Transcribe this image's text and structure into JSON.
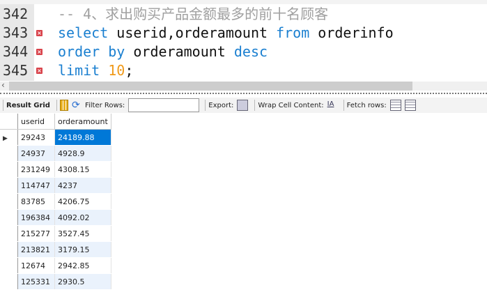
{
  "editor": {
    "lines": [
      {
        "num": "342",
        "error": false,
        "tokens": [
          {
            "t": "-- 4、求出购买产品金额最多的前十名顾客",
            "c": "cm"
          }
        ]
      },
      {
        "num": "343",
        "error": true,
        "tokens": [
          {
            "t": "select",
            "c": "kw"
          },
          {
            "t": " userid,orderamount ",
            "c": "id"
          },
          {
            "t": "from",
            "c": "kw"
          },
          {
            "t": " orderinfo",
            "c": "id"
          }
        ]
      },
      {
        "num": "344",
        "error": true,
        "tokens": [
          {
            "t": "order by",
            "c": "kw"
          },
          {
            "t": " orderamount ",
            "c": "id"
          },
          {
            "t": "desc",
            "c": "kw"
          }
        ]
      },
      {
        "num": "345",
        "error": true,
        "tokens": [
          {
            "t": "limit",
            "c": "kw"
          },
          {
            "t": " ",
            "c": "id"
          },
          {
            "t": "10",
            "c": "num"
          },
          {
            "t": ";",
            "c": "id"
          }
        ]
      }
    ]
  },
  "toolbar": {
    "result_grid": "Result Grid",
    "filter_rows": "Filter Rows:",
    "filter_value": "",
    "export": "Export:",
    "wrap": "Wrap Cell Content:",
    "fetch": "Fetch rows:"
  },
  "grid": {
    "columns": [
      "userid",
      "orderamount"
    ],
    "rows": [
      [
        "29243",
        "24189.88"
      ],
      [
        "24937",
        "4928.9"
      ],
      [
        "231249",
        "4308.15"
      ],
      [
        "114747",
        "4237"
      ],
      [
        "83785",
        "4206.75"
      ],
      [
        "196384",
        "4092.02"
      ],
      [
        "215277",
        "3527.45"
      ],
      [
        "213821",
        "3179.15"
      ],
      [
        "12674",
        "2942.85"
      ],
      [
        "125331",
        "2930.5"
      ]
    ]
  }
}
